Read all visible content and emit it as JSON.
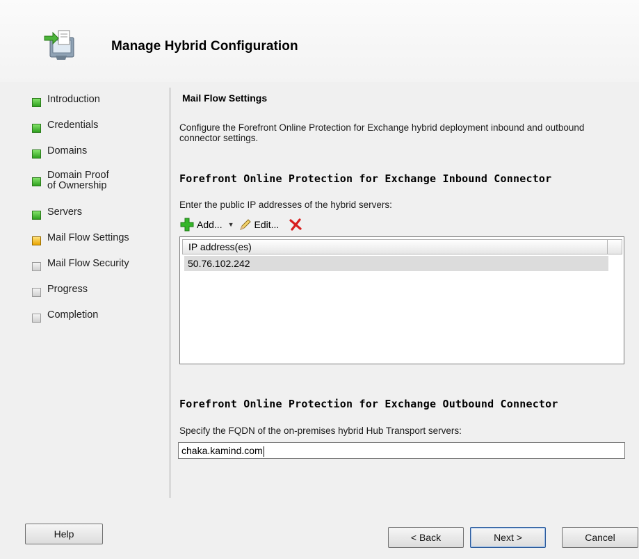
{
  "window": {
    "title": "Manage Hybrid Configuration"
  },
  "steps": [
    {
      "label": "Introduction",
      "state": "done"
    },
    {
      "label": "Credentials",
      "state": "done"
    },
    {
      "label": "Domains",
      "state": "done"
    },
    {
      "label": "Domain Proof of Ownership",
      "state": "done"
    },
    {
      "label": "Servers",
      "state": "done"
    },
    {
      "label": "Mail Flow Settings",
      "state": "current"
    },
    {
      "label": "Mail Flow Security",
      "state": "pending"
    },
    {
      "label": "Progress",
      "state": "pending"
    },
    {
      "label": "Completion",
      "state": "pending"
    }
  ],
  "content": {
    "section_title": "Mail Flow Settings",
    "description": "Configure the Forefront Online Protection for Exchange hybrid deployment inbound and outbound connector settings.",
    "inbound": {
      "heading": "Forefront Online Protection for Exchange Inbound Connector",
      "label": "Enter the public IP addresses of the hybrid servers:",
      "toolbar": {
        "add": "Add...",
        "edit": "Edit..."
      },
      "list_header": "IP address(es)",
      "rows": [
        "50.76.102.242"
      ]
    },
    "outbound": {
      "heading": "Forefront Online Protection for Exchange Outbound Connector",
      "label": "Specify the FQDN of the on-premises hybrid Hub Transport servers:",
      "fqdn_value": "chaka.kamind.com"
    }
  },
  "buttons": {
    "help": "Help",
    "back": "< Back",
    "next": "Next >",
    "cancel": "Cancel"
  },
  "colors": {
    "step_done": "#3fb52a",
    "step_current": "#f2b300",
    "step_pending": "#cfcfcf",
    "delete_red": "#d81e1e",
    "add_green": "#35b52a"
  }
}
